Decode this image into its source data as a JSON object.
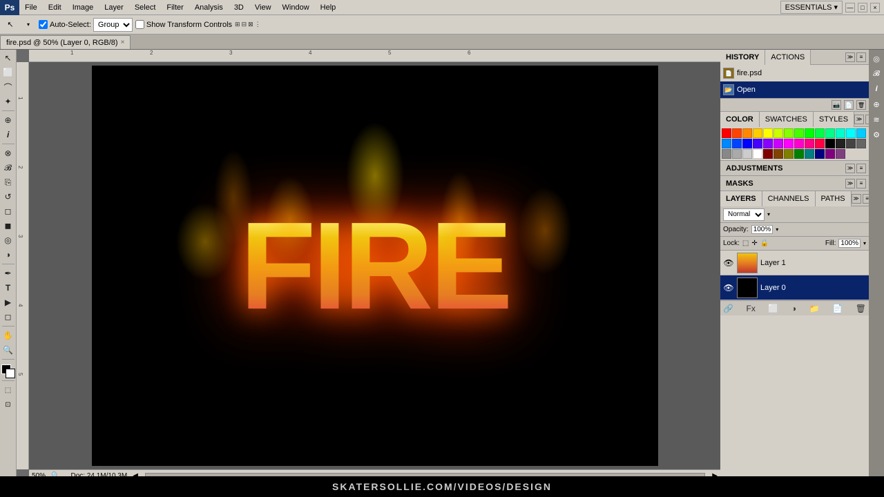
{
  "app": {
    "title": "Adobe Photoshop",
    "logo": "Ps"
  },
  "menubar": {
    "items": [
      "File",
      "Edit",
      "Image",
      "Layer",
      "Select",
      "Filter",
      "Analysis",
      "3D",
      "View",
      "Window",
      "Help"
    ],
    "essentials_label": "ESSENTIALS ▾"
  },
  "optionsbar": {
    "auto_select_label": "Auto-Select:",
    "group_label": "Group",
    "show_transform_label": "Show Transform Controls",
    "tool_icon": "↖"
  },
  "tab": {
    "label": "fire.psd @ 50% (Layer 0, RGB/8)",
    "close": "×"
  },
  "history_panel": {
    "tab1": "HISTORY",
    "tab2": "ACTIONS",
    "item1": "fire.psd",
    "item2": "Open",
    "item2_selected": true
  },
  "color_panel": {
    "tab1": "COLOR",
    "tab2": "SWATCHES",
    "tab3": "STYLES",
    "swatches": [
      "#ff0000",
      "#ff4400",
      "#ff8800",
      "#ffcc00",
      "#ffff00",
      "#ccff00",
      "#88ff00",
      "#44ff00",
      "#00ff00",
      "#00ff44",
      "#00ff88",
      "#00ffcc",
      "#00ffff",
      "#00ccff",
      "#0088ff",
      "#0044ff",
      "#0000ff",
      "#4400ff",
      "#8800ff",
      "#cc00ff",
      "#ff00ff",
      "#ff00cc",
      "#ff0088",
      "#ff0044",
      "#000000",
      "#222222",
      "#444444",
      "#666666",
      "#888888",
      "#aaaaaa",
      "#cccccc",
      "#ffffff",
      "#800000",
      "#804400",
      "#808000",
      "#008000",
      "#008080",
      "#000080",
      "#800080",
      "#804080"
    ]
  },
  "adjustments": {
    "label": "ADJUSTMENTS"
  },
  "masks": {
    "label": "MASKS"
  },
  "layers_panel": {
    "header_label": "LAYERS",
    "channels_label": "CHANNELS",
    "paths_label": "PATHS",
    "blend_mode": "Normal",
    "opacity_label": "Opacity:",
    "opacity_value": "100%",
    "fill_label": "Fill:",
    "fill_value": "100%",
    "lock_label": "Lock:",
    "layers": [
      {
        "name": "Layer 1",
        "visible": true,
        "selected": false,
        "type": "fire"
      },
      {
        "name": "Layer 0",
        "visible": true,
        "selected": true,
        "type": "black"
      }
    ]
  },
  "statusbar": {
    "zoom": "50%",
    "doc_info": "Doc: 24.1M/10.3M"
  },
  "watermark": {
    "text": "SKATERSOLLIE.COM/VIDEOS/DESIGN"
  },
  "canvas": {
    "fire_text": "FIRE"
  }
}
